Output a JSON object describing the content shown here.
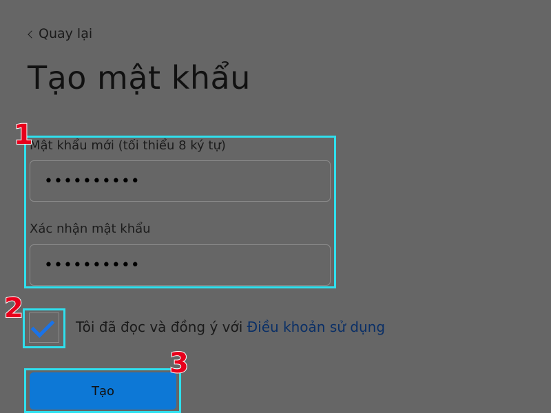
{
  "back": {
    "label": "Quay lại",
    "icon": "chevron-left-icon"
  },
  "title": "Tạo mật khẩu",
  "form": {
    "new_password": {
      "label": "Mật khẩu mới (tối thiểu 8 ký tự)",
      "value": "••••••••••"
    },
    "confirm_password": {
      "label": "Xác nhận mật khẩu",
      "value": "••••••••••"
    },
    "agree": {
      "checked": true,
      "text": "Tôi đã đọc và đồng ý với ",
      "link": "Điều khoản sử dụng"
    },
    "submit_label": "Tạo"
  },
  "annotations": {
    "step1": "1",
    "step2": "2",
    "step3": "3",
    "highlight_color": "#2fe0ee",
    "number_color": "#e8001c"
  },
  "colors": {
    "background": "#666666",
    "primary": "#0d78d6",
    "check": "#1a73e8",
    "link": "#0a2f66"
  }
}
